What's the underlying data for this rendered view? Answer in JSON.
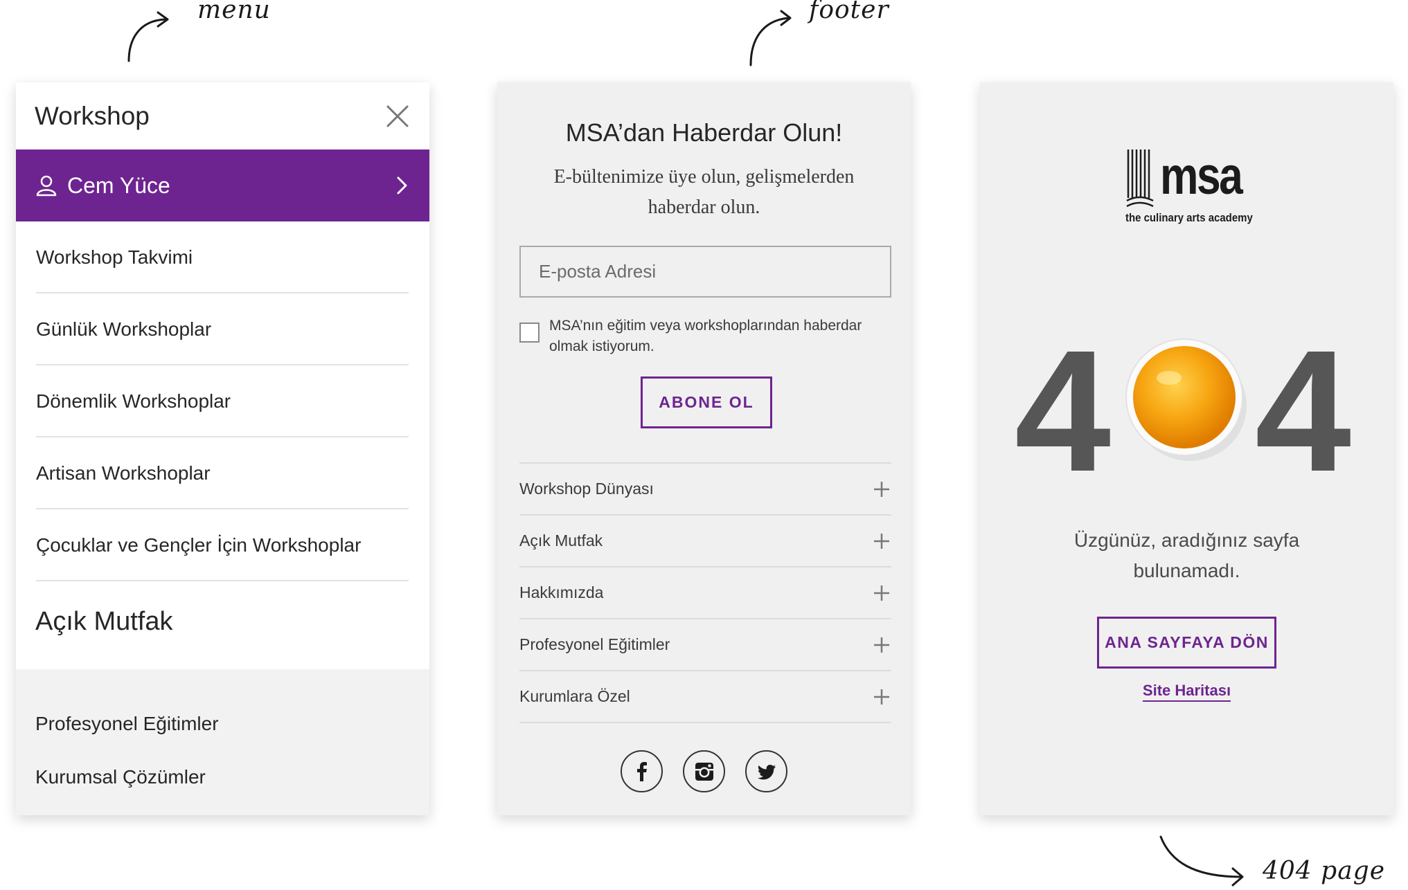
{
  "annotations": {
    "menu": "menu",
    "footer": "footer",
    "page404": "404 page"
  },
  "menu": {
    "title": "Workshop",
    "user_name": "Cem Yüce",
    "items": [
      {
        "label": "Workshop Takvimi"
      },
      {
        "label": "Günlük Workshoplar"
      },
      {
        "label": "Dönemlik Workshoplar"
      },
      {
        "label": "Artisan Workshoplar"
      },
      {
        "label": "Çocuklar ve Gençler İçin Workshoplar"
      }
    ],
    "section": "Açık Mutfak",
    "secondary": [
      {
        "label": "Profesyonel Eğitimler"
      },
      {
        "label": "Kurumsal Çözümler"
      }
    ],
    "accent_color": "#6e2490"
  },
  "footer": {
    "title": "MSA’dan Haberdar Olun!",
    "description": "E-bültenimize üye olun, gelişmelerden haberdar olun.",
    "email_placeholder": "E-posta Adresi",
    "consent_text": "MSA’nın eğitim veya workshoplarından haberdar olmak istiyorum.",
    "subscribe_label": "ABONE OL",
    "links": [
      {
        "label": "Workshop Dünyası"
      },
      {
        "label": "Açık Mutfak"
      },
      {
        "label": "Hakkımızda"
      },
      {
        "label": "Profesyonel Eğitimler"
      },
      {
        "label": "Kurumlara Özel"
      }
    ],
    "social_icons": [
      "facebook-icon",
      "instagram-icon",
      "twitter-icon"
    ]
  },
  "error_page": {
    "logo_name": "msa",
    "logo_tagline": "the culinary arts academy",
    "code_left": "4",
    "code_right": "4",
    "message": "Üzgünüz, aradığınız sayfa bulunamadı.",
    "home_label": "ANA SAYFAYA DÖN",
    "sitemap_label": "Site Haritası"
  }
}
